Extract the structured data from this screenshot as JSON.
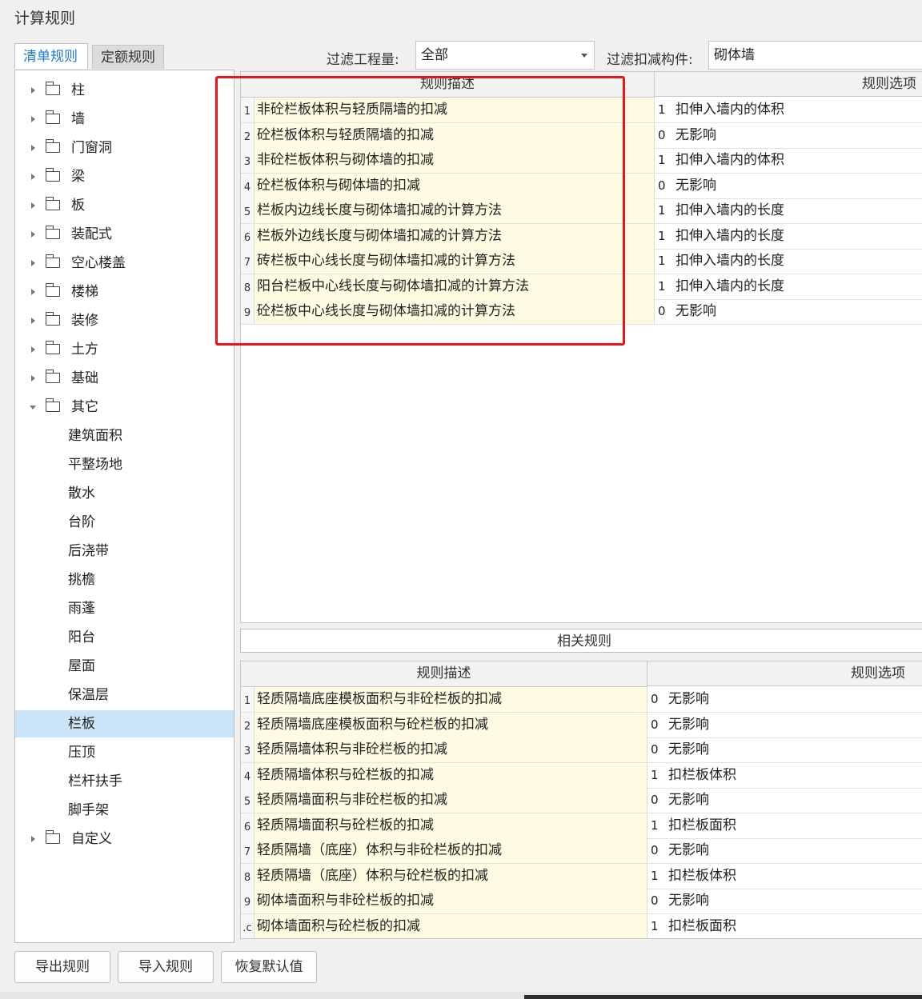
{
  "window": {
    "title": "计算规则"
  },
  "tabs": [
    {
      "label": "清单规则",
      "active": true
    },
    {
      "label": "定额规则",
      "active": false
    }
  ],
  "filters": {
    "project_label": "过滤工程量:",
    "project_value": "全部",
    "component_label": "过滤扣减构件:",
    "component_value": "砌体墙"
  },
  "tree": {
    "folders": [
      "柱",
      "墙",
      "门窗洞",
      "梁",
      "板",
      "装配式",
      "空心楼盖",
      "楼梯",
      "装修",
      "土方",
      "基础",
      "其它"
    ],
    "other_children": [
      "建筑面积",
      "平整场地",
      "散水",
      "台阶",
      "后浇带",
      "挑檐",
      "雨蓬",
      "阳台",
      "屋面",
      "保温层",
      "栏板",
      "压顶",
      "栏杆扶手",
      "脚手架"
    ],
    "selected": "栏板",
    "last_folder": "自定义"
  },
  "main_grid": {
    "col_desc": "规则描述",
    "col_opt": "规则选项",
    "rows": [
      {
        "num": "1",
        "desc": "非砼栏板体积与轻质隔墙的扣减",
        "code": "1",
        "opt": "扣伸入墙内的体积"
      },
      {
        "num": "2",
        "desc": "砼栏板体积与轻质隔墙的扣减",
        "code": "0",
        "opt": "无影响"
      },
      {
        "num": "3",
        "desc": "非砼栏板体积与砌体墙的扣减",
        "code": "1",
        "opt": "扣伸入墙内的体积"
      },
      {
        "num": "4",
        "desc": "砼栏板体积与砌体墙的扣减",
        "code": "0",
        "opt": "无影响"
      },
      {
        "num": "5",
        "desc": "栏板内边线长度与砌体墙扣减的计算方法",
        "code": "1",
        "opt": "扣伸入墙内的长度"
      },
      {
        "num": "6",
        "desc": "栏板外边线长度与砌体墙扣减的计算方法",
        "code": "1",
        "opt": "扣伸入墙内的长度"
      },
      {
        "num": "7",
        "desc": "砖栏板中心线长度与砌体墙扣减的计算方法",
        "code": "1",
        "opt": "扣伸入墙内的长度"
      },
      {
        "num": "8",
        "desc": "阳台栏板中心线长度与砌体墙扣减的计算方法",
        "code": "1",
        "opt": "扣伸入墙内的长度"
      },
      {
        "num": "9",
        "desc": "砼栏板中心线长度与砌体墙扣减的计算方法",
        "code": "0",
        "opt": "无影响"
      }
    ]
  },
  "related": {
    "title": "相关规则"
  },
  "related_grid": {
    "col_desc": "规则描述",
    "col_opt": "规则选项",
    "rows": [
      {
        "num": "1",
        "desc": "轻质隔墙底座模板面积与非砼栏板的扣减",
        "code": "0",
        "opt": "无影响"
      },
      {
        "num": "2",
        "desc": "轻质隔墙底座模板面积与砼栏板的扣减",
        "code": "0",
        "opt": "无影响"
      },
      {
        "num": "3",
        "desc": "轻质隔墙体积与非砼栏板的扣减",
        "code": "0",
        "opt": "无影响"
      },
      {
        "num": "4",
        "desc": "轻质隔墙体积与砼栏板的扣减",
        "code": "1",
        "opt": "扣栏板体积"
      },
      {
        "num": "5",
        "desc": "轻质隔墙面积与非砼栏板的扣减",
        "code": "0",
        "opt": "无影响"
      },
      {
        "num": "6",
        "desc": "轻质隔墙面积与砼栏板的扣减",
        "code": "1",
        "opt": "扣栏板面积"
      },
      {
        "num": "7",
        "desc": "轻质隔墙（底座）体积与非砼栏板的扣减",
        "code": "0",
        "opt": "无影响"
      },
      {
        "num": "8",
        "desc": "轻质隔墙（底座）体积与砼栏板的扣减",
        "code": "1",
        "opt": "扣栏板体积"
      },
      {
        "num": "9",
        "desc": "砌体墙面积与非砼栏板的扣减",
        "code": "0",
        "opt": "无影响"
      },
      {
        "num": ".c",
        "desc": "砌体墙面积与砼栏板的扣减",
        "code": "1",
        "opt": "扣栏板面积"
      }
    ]
  },
  "buttons": {
    "export": "导出规则",
    "import": "导入规则",
    "restore": "恢复默认值"
  }
}
